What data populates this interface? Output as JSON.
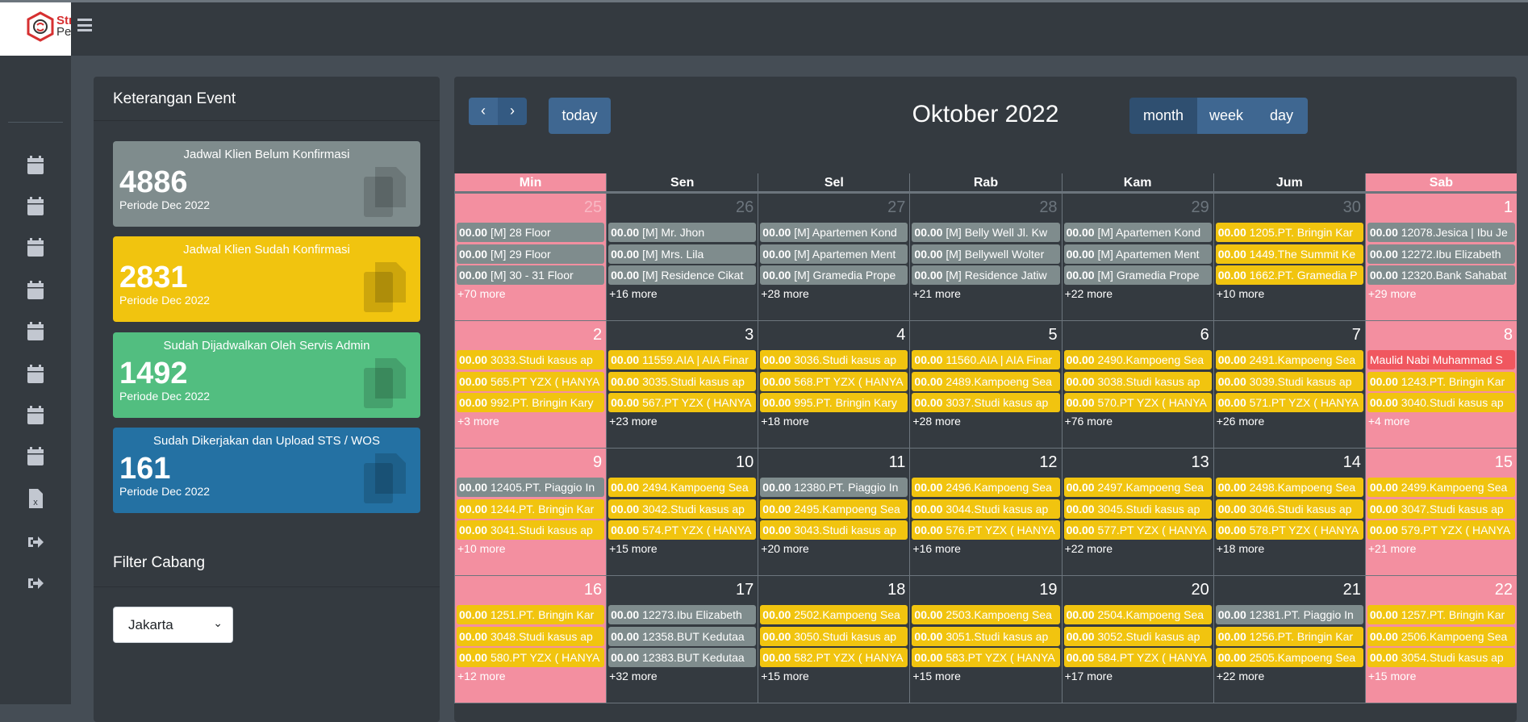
{
  "brand": {
    "logo_text_1": "Str",
    "logo_text_2": "Pe"
  },
  "colors": {
    "gray": "#7f8c8d",
    "yellow": "#f1c40f",
    "red": "#f0575f",
    "weekend": "#f38fa0",
    "green": "#52be80",
    "blue": "#2471a3"
  },
  "sidebar": {
    "icons": [
      "calendar-icon",
      "calendar-icon",
      "calendar-icon",
      "calendar-icon",
      "calendar-icon",
      "calendar-icon",
      "calendar-icon",
      "calendar-icon",
      "file-excel-icon",
      "sign-out-icon",
      "sign-out-icon"
    ]
  },
  "left_panel": {
    "title": "Keterangan Event",
    "cards": [
      {
        "title": "Jadwal Klien Belum Konfirmasi",
        "count": "4886",
        "period": "Periode Dec 2022",
        "color": "#7f8c8d"
      },
      {
        "title": "Jadwal Klien Sudah Konfirmasi",
        "count": "2831",
        "period": "Periode Dec 2022",
        "color": "#f1c40f"
      },
      {
        "title": "Sudah Dijadwalkan Oleh Servis Admin",
        "count": "1492",
        "period": "Periode Dec 2022",
        "color": "#52be80"
      },
      {
        "title": "Sudah Dikerjakan dan Upload STS / WOS",
        "count": "161",
        "period": "Periode Dec 2022",
        "color": "#2471a3"
      }
    ],
    "filter_title": "Filter Cabang",
    "filter_value": "Jakarta"
  },
  "calendar": {
    "title": "Oktober 2022",
    "today_label": "today",
    "views": [
      "month",
      "week",
      "day"
    ],
    "active_view": "month",
    "weekdays": [
      "Min",
      "Sen",
      "Sel",
      "Rab",
      "Kam",
      "Jum",
      "Sab"
    ],
    "weeks": [
      [
        {
          "num": "25",
          "other": true,
          "events": [
            [
              "00.00",
              "[M] 28 Floor",
              "g"
            ],
            [
              "00.00",
              "[M] 29 Floor",
              "g"
            ],
            [
              "00.00",
              "[M] 30 - 31 Floor",
              "g"
            ]
          ],
          "more": "+70 more"
        },
        {
          "num": "26",
          "other": true,
          "events": [
            [
              "00.00",
              "[M] Mr. Jhon",
              "g"
            ],
            [
              "00.00",
              "[M] Mrs. Lila",
              "g"
            ],
            [
              "00.00",
              "[M] Residence Cikat",
              "g"
            ]
          ],
          "more": "+16 more"
        },
        {
          "num": "27",
          "other": true,
          "events": [
            [
              "00.00",
              "[M] Apartemen Kond",
              "g"
            ],
            [
              "00.00",
              "[M] Apartemen Ment",
              "g"
            ],
            [
              "00.00",
              "[M] Gramedia Prope",
              "g"
            ]
          ],
          "more": "+28 more"
        },
        {
          "num": "28",
          "other": true,
          "events": [
            [
              "00.00",
              "[M] Belly Well Jl. Kw",
              "g"
            ],
            [
              "00.00",
              "[M] Bellywell Wolter",
              "g"
            ],
            [
              "00.00",
              "[M] Residence Jatiw",
              "g"
            ]
          ],
          "more": "+21 more"
        },
        {
          "num": "29",
          "other": true,
          "events": [
            [
              "00.00",
              "[M] Apartemen Kond",
              "g"
            ],
            [
              "00.00",
              "[M] Apartemen Ment",
              "g"
            ],
            [
              "00.00",
              "[M] Gramedia Prope",
              "g"
            ]
          ],
          "more": "+22 more"
        },
        {
          "num": "30",
          "other": true,
          "events": [
            [
              "00.00",
              "1205.PT. Bringin Kar",
              "y"
            ],
            [
              "00.00",
              "1449.The Summit Ke",
              "y"
            ],
            [
              "00.00",
              "1662.PT. Gramedia P",
              "y"
            ]
          ],
          "more": "+10 more"
        },
        {
          "num": "1",
          "events": [
            [
              "00.00",
              "12078.Jesica | Ibu Je",
              "g"
            ],
            [
              "00.00",
              "12272.Ibu Elizabeth",
              "g"
            ],
            [
              "00.00",
              "12320.Bank Sahabat",
              "g"
            ]
          ],
          "more": "+29 more"
        }
      ],
      [
        {
          "num": "2",
          "events": [
            [
              "00.00",
              "3033.Studi kasus ap",
              "y"
            ],
            [
              "00.00",
              "565.PT YZX ( HANYA",
              "y"
            ],
            [
              "00.00",
              "992.PT. Bringin Kary",
              "y"
            ]
          ],
          "more": "+3 more"
        },
        {
          "num": "3",
          "events": [
            [
              "00.00",
              "11559.AIA | AIA Finar",
              "y"
            ],
            [
              "00.00",
              "3035.Studi kasus ap",
              "y"
            ],
            [
              "00.00",
              "567.PT YZX ( HANYA",
              "y"
            ]
          ],
          "more": "+23 more"
        },
        {
          "num": "4",
          "events": [
            [
              "00.00",
              "3036.Studi kasus ap",
              "y"
            ],
            [
              "00.00",
              "568.PT YZX ( HANYA",
              "y"
            ],
            [
              "00.00",
              "995.PT. Bringin Kary",
              "y"
            ]
          ],
          "more": "+18 more"
        },
        {
          "num": "5",
          "events": [
            [
              "00.00",
              "11560.AIA | AIA Finar",
              "y"
            ],
            [
              "00.00",
              "2489.Kampoeng Sea",
              "y"
            ],
            [
              "00.00",
              "3037.Studi kasus ap",
              "y"
            ]
          ],
          "more": "+28 more"
        },
        {
          "num": "6",
          "events": [
            [
              "00.00",
              "2490.Kampoeng Sea",
              "y"
            ],
            [
              "00.00",
              "3038.Studi kasus ap",
              "y"
            ],
            [
              "00.00",
              "570.PT YZX ( HANYA",
              "y"
            ]
          ],
          "more": "+76 more"
        },
        {
          "num": "7",
          "events": [
            [
              "00.00",
              "2491.Kampoeng Sea",
              "y"
            ],
            [
              "00.00",
              "3039.Studi kasus ap",
              "y"
            ],
            [
              "00.00",
              "571.PT YZX ( HANYA",
              "y"
            ]
          ],
          "more": "+26 more"
        },
        {
          "num": "8",
          "events": [
            [
              "",
              "Maulid Nabi Muhammad S",
              "r"
            ],
            [
              "00.00",
              "1243.PT. Bringin Kar",
              "y"
            ],
            [
              "00.00",
              "3040.Studi kasus ap",
              "y"
            ]
          ],
          "more": "+4 more"
        }
      ],
      [
        {
          "num": "9",
          "events": [
            [
              "00.00",
              "12405.PT. Piaggio In",
              "g"
            ],
            [
              "00.00",
              "1244.PT. Bringin Kar",
              "y"
            ],
            [
              "00.00",
              "3041.Studi kasus ap",
              "y"
            ]
          ],
          "more": "+10 more"
        },
        {
          "num": "10",
          "events": [
            [
              "00.00",
              "2494.Kampoeng Sea",
              "y"
            ],
            [
              "00.00",
              "3042.Studi kasus ap",
              "y"
            ],
            [
              "00.00",
              "574.PT YZX ( HANYA",
              "y"
            ]
          ],
          "more": "+15 more"
        },
        {
          "num": "11",
          "events": [
            [
              "00.00",
              "12380.PT. Piaggio In",
              "g"
            ],
            [
              "00.00",
              "2495.Kampoeng Sea",
              "y"
            ],
            [
              "00.00",
              "3043.Studi kasus ap",
              "y"
            ]
          ],
          "more": "+20 more"
        },
        {
          "num": "12",
          "events": [
            [
              "00.00",
              "2496.Kampoeng Sea",
              "y"
            ],
            [
              "00.00",
              "3044.Studi kasus ap",
              "y"
            ],
            [
              "00.00",
              "576.PT YZX ( HANYA",
              "y"
            ]
          ],
          "more": "+16 more"
        },
        {
          "num": "13",
          "events": [
            [
              "00.00",
              "2497.Kampoeng Sea",
              "y"
            ],
            [
              "00.00",
              "3045.Studi kasus ap",
              "y"
            ],
            [
              "00.00",
              "577.PT YZX ( HANYA",
              "y"
            ]
          ],
          "more": "+22 more"
        },
        {
          "num": "14",
          "events": [
            [
              "00.00",
              "2498.Kampoeng Sea",
              "y"
            ],
            [
              "00.00",
              "3046.Studi kasus ap",
              "y"
            ],
            [
              "00.00",
              "578.PT YZX ( HANYA",
              "y"
            ]
          ],
          "more": "+18 more"
        },
        {
          "num": "15",
          "events": [
            [
              "00.00",
              "2499.Kampoeng Sea",
              "y"
            ],
            [
              "00.00",
              "3047.Studi kasus ap",
              "y"
            ],
            [
              "00.00",
              "579.PT YZX ( HANYA",
              "y"
            ]
          ],
          "more": "+21 more"
        }
      ],
      [
        {
          "num": "16",
          "events": [
            [
              "00.00",
              "1251.PT. Bringin Kar",
              "y"
            ],
            [
              "00.00",
              "3048.Studi kasus ap",
              "y"
            ],
            [
              "00.00",
              "580.PT YZX ( HANYA",
              "y"
            ]
          ],
          "more": "+12 more"
        },
        {
          "num": "17",
          "events": [
            [
              "00.00",
              "12273.Ibu Elizabeth",
              "g"
            ],
            [
              "00.00",
              "12358.BUT Kedutaa",
              "g"
            ],
            [
              "00.00",
              "12383.BUT Kedutaa",
              "g"
            ]
          ],
          "more": "+32 more"
        },
        {
          "num": "18",
          "events": [
            [
              "00.00",
              "2502.Kampoeng Sea",
              "y"
            ],
            [
              "00.00",
              "3050.Studi kasus ap",
              "y"
            ],
            [
              "00.00",
              "582.PT YZX ( HANYA",
              "y"
            ]
          ],
          "more": "+15 more"
        },
        {
          "num": "19",
          "events": [
            [
              "00.00",
              "2503.Kampoeng Sea",
              "y"
            ],
            [
              "00.00",
              "3051.Studi kasus ap",
              "y"
            ],
            [
              "00.00",
              "583.PT YZX ( HANYA",
              "y"
            ]
          ],
          "more": "+15 more"
        },
        {
          "num": "20",
          "events": [
            [
              "00.00",
              "2504.Kampoeng Sea",
              "y"
            ],
            [
              "00.00",
              "3052.Studi kasus ap",
              "y"
            ],
            [
              "00.00",
              "584.PT YZX ( HANYA",
              "y"
            ]
          ],
          "more": "+17 more"
        },
        {
          "num": "21",
          "events": [
            [
              "00.00",
              "12381.PT. Piaggio In",
              "g"
            ],
            [
              "00.00",
              "1256.PT. Bringin Kar",
              "y"
            ],
            [
              "00.00",
              "2505.Kampoeng Sea",
              "y"
            ]
          ],
          "more": "+22 more"
        },
        {
          "num": "22",
          "events": [
            [
              "00.00",
              "1257.PT. Bringin Kar",
              "y"
            ],
            [
              "00.00",
              "2506.Kampoeng Sea",
              "y"
            ],
            [
              "00.00",
              "3054.Studi kasus ap",
              "y"
            ]
          ],
          "more": "+15 more"
        }
      ]
    ]
  }
}
